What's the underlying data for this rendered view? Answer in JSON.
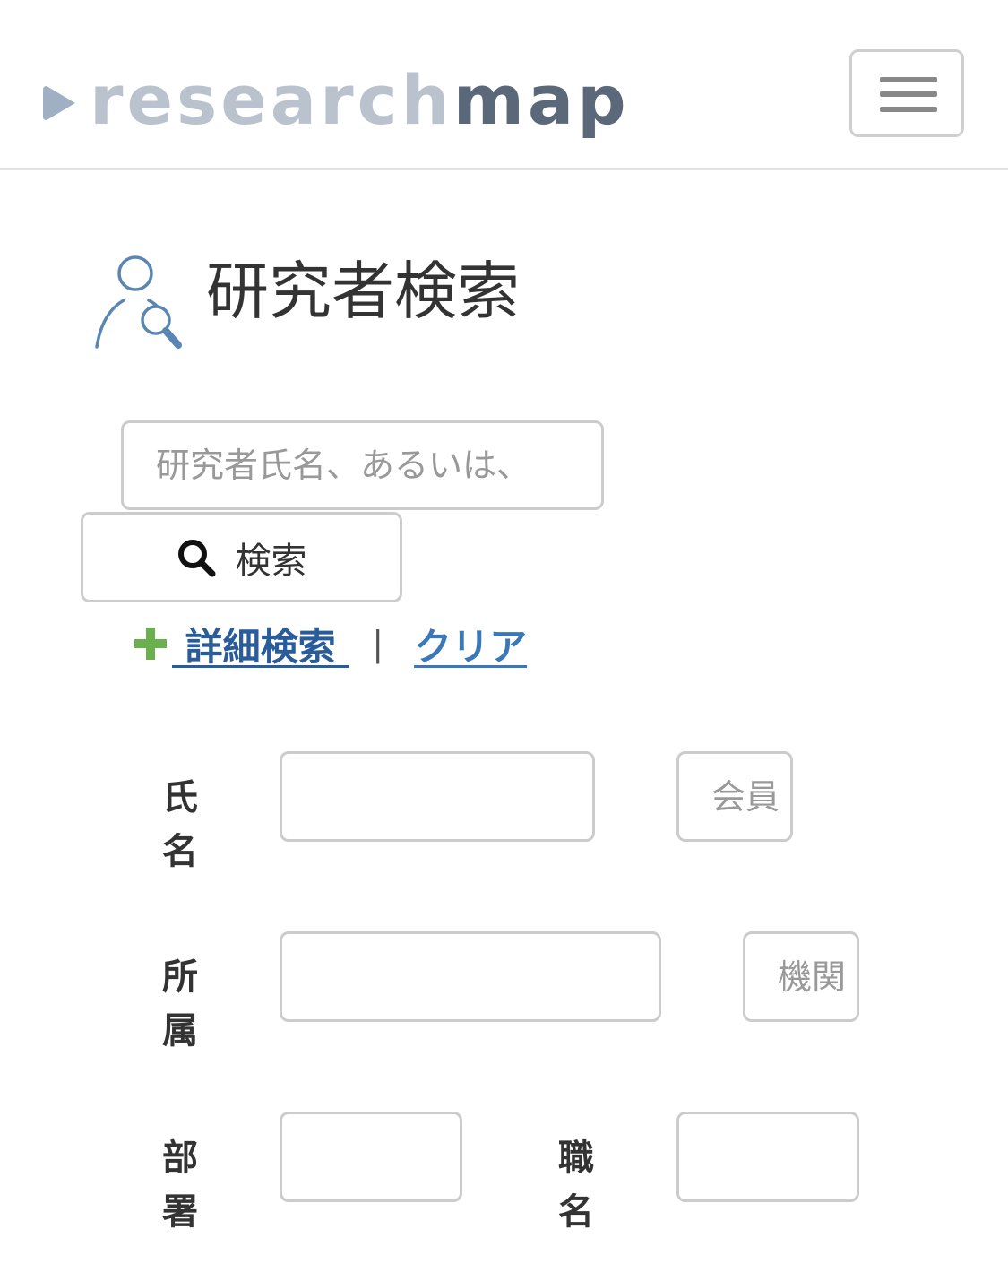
{
  "header": {
    "logo_part1": "research",
    "logo_part2": "map",
    "logo_mark_icon": "play-triangle-icon",
    "menu_icon": "hamburger-menu-icon"
  },
  "page": {
    "title": "研究者検索",
    "title_icon": "researcher-search-icon"
  },
  "quick_search": {
    "placeholder": "研究者氏名、あるいは、",
    "button_label": "検索",
    "button_icon": "search-icon"
  },
  "links": {
    "detail_label": " 詳細検索 ",
    "separator": "|",
    "clear_label": "クリア",
    "detail_icon": "plus-icon"
  },
  "form": {
    "name_label": "氏名",
    "member_placeholder": "会員",
    "affiliation_label": "所属",
    "institution_placeholder": "機関",
    "department_label": "部署",
    "position_label": "職名"
  },
  "colors": {
    "link": "#285c9b",
    "plus": "#6ab04c",
    "logo_light": "#b9c2cd",
    "logo_dark": "#5b6879",
    "icon_blue": "#5a86b3"
  }
}
